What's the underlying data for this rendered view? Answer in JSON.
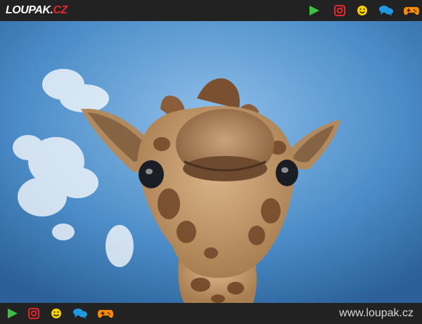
{
  "header": {
    "logo_main": "LOUPAK.",
    "logo_tld": "CZ"
  },
  "icons": [
    "play-icon",
    "instagram-icon",
    "smiley-icon",
    "chat-icon",
    "gamepad-icon"
  ],
  "colors": {
    "bar_bg": "#222222",
    "play": "#3fbf3f",
    "instagram": "#e3262f",
    "smiley": "#f5d100",
    "chat": "#1e9ae0",
    "gamepad": "#ff8a00",
    "sky": "#4c8dc8"
  },
  "footer": {
    "url": "www.loupak.cz"
  }
}
